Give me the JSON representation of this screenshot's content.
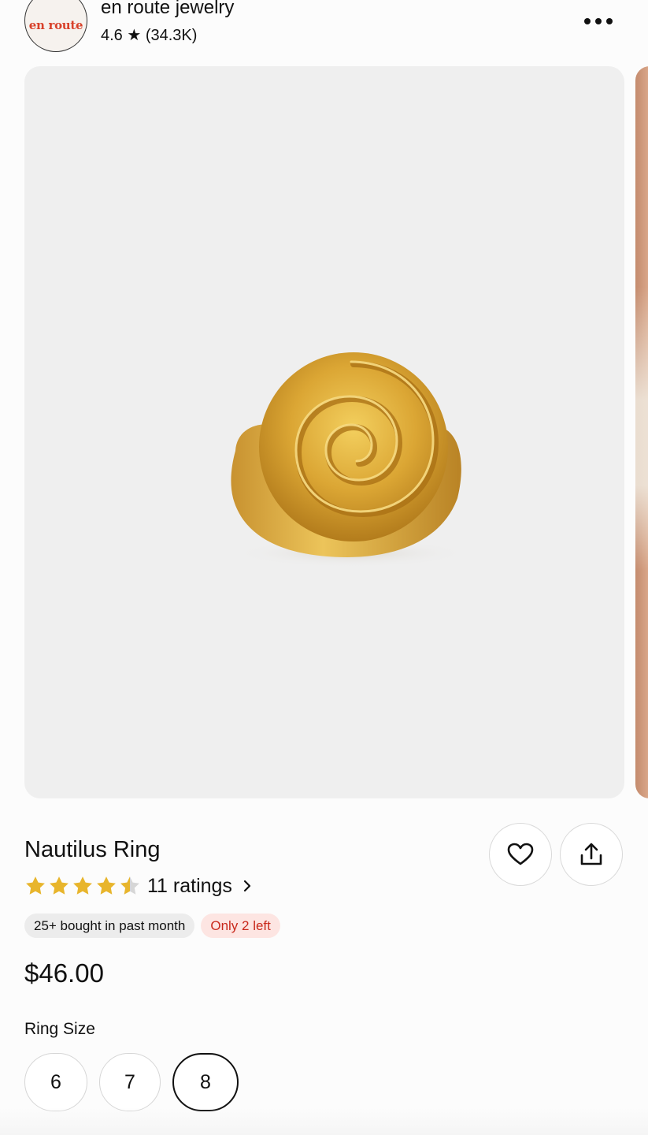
{
  "shop": {
    "logo_text": "en route",
    "name": "en route jewelry",
    "rating_line": "4.6 ★ (34.3K)",
    "more_icon": "ellipsis-icon"
  },
  "product": {
    "title": "Nautilus Ring",
    "stars": 4.5,
    "ratings_text": "11 ratings",
    "price": "$46.00",
    "badges": {
      "bought": "25+ bought in past month",
      "stock": "Only 2 left"
    },
    "favorite_icon": "heart-icon",
    "share_icon": "share-icon"
  },
  "ring_size": {
    "label": "Ring Size",
    "options": [
      "6",
      "7",
      "8"
    ],
    "selected": "8"
  },
  "colors": {
    "star": "#e8b52c",
    "stock_text": "#c9291c",
    "stock_bg": "#fde5e2",
    "logo_text": "#d8412a",
    "image_bg": "#efefef"
  }
}
